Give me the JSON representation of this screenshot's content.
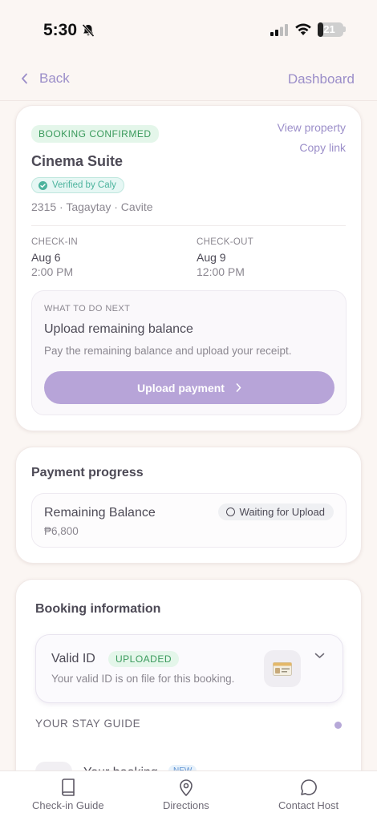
{
  "status_bar": {
    "time": "5:30",
    "battery": "21",
    "battery_level": 0.21
  },
  "nav": {
    "back_label": "Back",
    "dashboard_label": "Dashboard"
  },
  "booking": {
    "status_badge": "BOOKING CONFIRMED",
    "view_property": "View property",
    "copy_link": "Copy link",
    "title": "Cinema Suite",
    "verified": "Verified by Caly",
    "address": "2315 · Tagaytay · Cavite",
    "check_in": {
      "label": "CHECK-IN",
      "date": "Aug 6",
      "time": "2:00 PM"
    },
    "check_out": {
      "label": "CHECK-OUT",
      "date": "Aug 9",
      "time": "12:00 PM"
    },
    "next": {
      "label": "WHAT TO DO NEXT",
      "title": "Upload remaining balance",
      "description": "Pay the remaining balance and upload your receipt.",
      "button": "Upload payment"
    }
  },
  "payment": {
    "title": "Payment progress",
    "balance_label": "Remaining Balance",
    "balance_value": "₱6,800",
    "status": "Waiting for Upload"
  },
  "info": {
    "title": "Booking information",
    "id_title": "Valid ID",
    "id_badge": "UPLOADED",
    "id_desc": "Your valid ID is on file for this booking.",
    "stay_guide": "YOUR STAY GUIDE",
    "guide_item": "Your booking",
    "guide_badge": "NEW"
  },
  "tabbar": {
    "items": [
      {
        "label": "Check-in Guide",
        "icon": "book-icon"
      },
      {
        "label": "Directions",
        "icon": "map-pin-icon"
      },
      {
        "label": "Contact Host",
        "icon": "chat-icon"
      }
    ]
  },
  "colors": {
    "accent": "#9b8ec9",
    "button": "#b7a4d8",
    "success": "#3a9a5c",
    "background": "#fbf6f3"
  }
}
